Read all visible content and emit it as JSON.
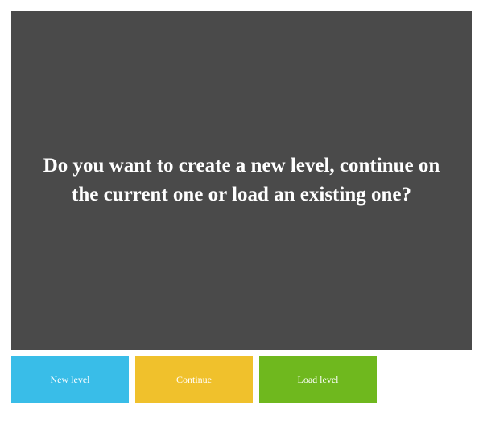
{
  "dialog": {
    "message": "Do you want to create a new level, continue on the current one or load an existing one?"
  },
  "buttons": {
    "new_level": "New level",
    "continue": "Continue",
    "load_level": "Load level"
  }
}
